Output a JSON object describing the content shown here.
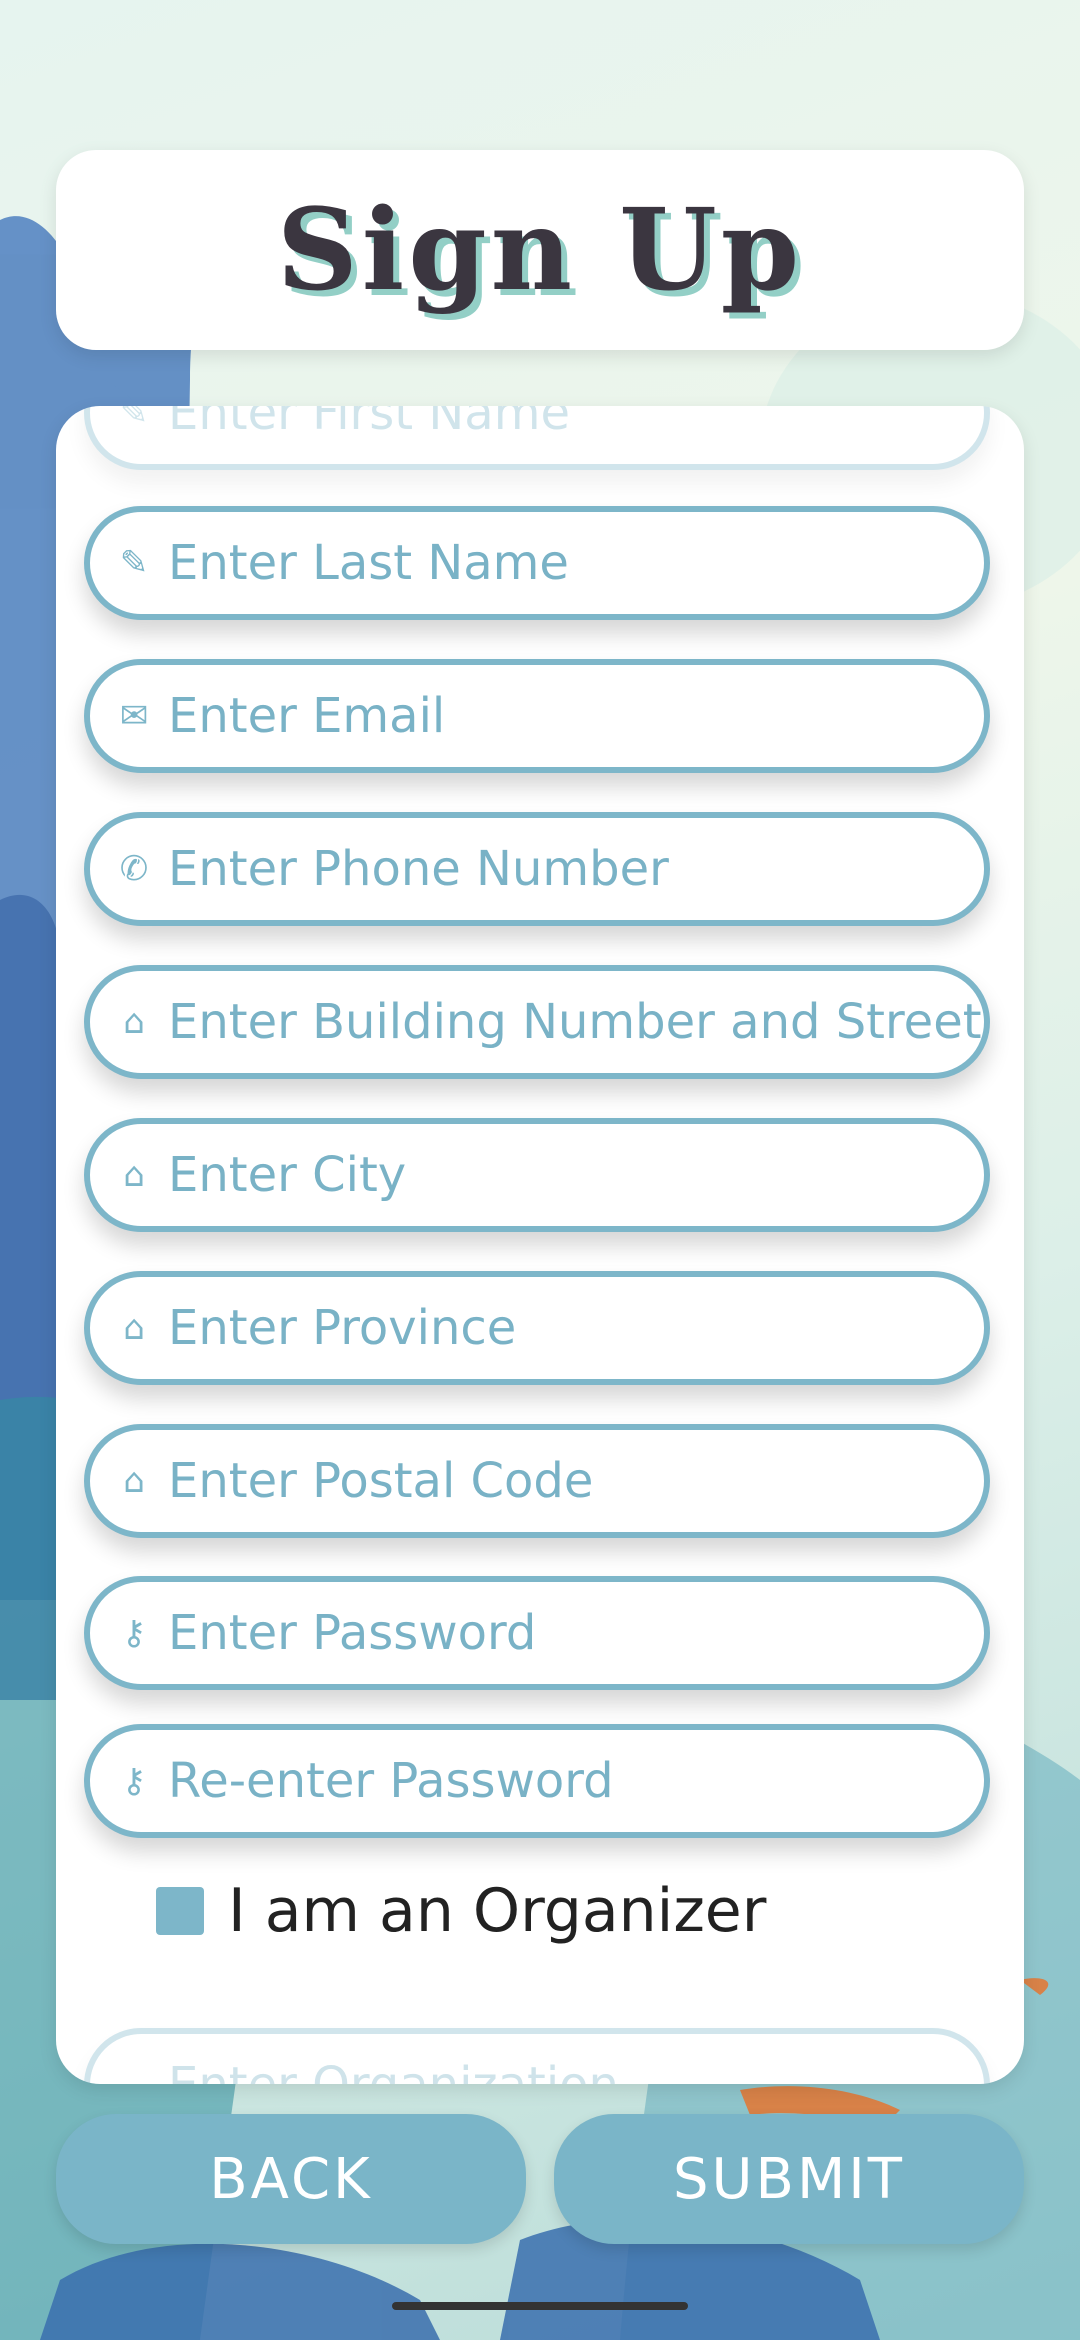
{
  "header": {
    "title": "Sign Up"
  },
  "form": {
    "fields": [
      {
        "icon": "pencil-icon",
        "placeholder": "Enter First Name"
      },
      {
        "icon": "pencil-icon",
        "placeholder": "Enter Last Name"
      },
      {
        "icon": "envelope-icon",
        "placeholder": "Enter Email"
      },
      {
        "icon": "phone-icon",
        "placeholder": "Enter Phone Number"
      },
      {
        "icon": "house-icon",
        "placeholder": "Enter Building Number and Street"
      },
      {
        "icon": "house-icon",
        "placeholder": "Enter City"
      },
      {
        "icon": "house-icon",
        "placeholder": "Enter Province"
      },
      {
        "icon": "house-icon",
        "placeholder": "Enter Postal Code"
      },
      {
        "icon": "key-icon",
        "placeholder": "Enter Password"
      },
      {
        "icon": "key-icon",
        "placeholder": "Re-enter Password"
      }
    ],
    "organizer_checkbox": {
      "label": "I am an Organizer",
      "checked": false
    },
    "organization_field": {
      "placeholder": "Enter Organization"
    }
  },
  "buttons": {
    "back": "BACK",
    "submit": "SUBMIT"
  },
  "colors": {
    "accent": "#7db6c9",
    "title_text": "#3b3640",
    "title_shadow": "#93cfc6"
  }
}
